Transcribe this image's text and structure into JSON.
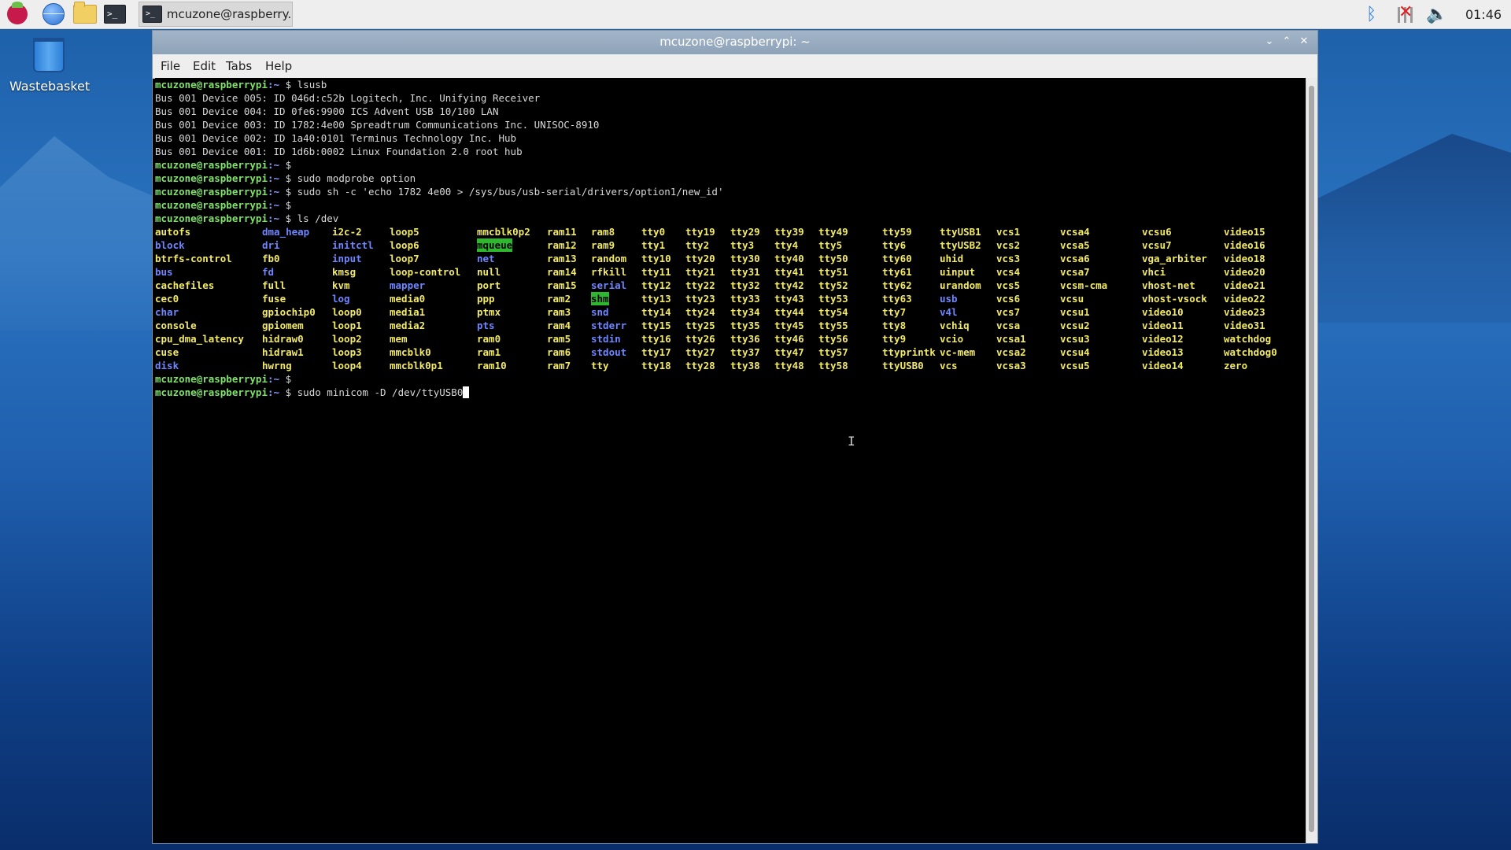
{
  "taskbar": {
    "launchers": [
      "raspberry-menu",
      "web-browser",
      "file-manager",
      "terminal"
    ],
    "active_task": {
      "label": "mcuzone@raspberry...",
      "icon": "terminal-icon"
    },
    "tray": {
      "bluetooth": "bluetooth-icon",
      "network": "network-disconnected-icon",
      "volume": "volume-icon"
    },
    "clock": "01:46"
  },
  "desktop": {
    "icons": [
      {
        "label": "Wastebasket",
        "icon": "trash-icon"
      }
    ]
  },
  "window": {
    "title": "mcuzone@raspberrypi: ~",
    "controls": [
      "minimize",
      "maximize",
      "close"
    ],
    "menu": [
      "File",
      "Edit",
      "Tabs",
      "Help"
    ]
  },
  "terminal": {
    "prompt": {
      "user": "mcuzone@raspberrypi",
      "path": "~",
      "symbol": "$"
    },
    "lines": [
      {
        "type": "cmd",
        "text": "lsusb"
      },
      {
        "type": "out",
        "text": "Bus 001 Device 005: ID 046d:c52b Logitech, Inc. Unifying Receiver"
      },
      {
        "type": "out",
        "text": "Bus 001 Device 004: ID 0fe6:9900 ICS Advent USB 10/100 LAN"
      },
      {
        "type": "out",
        "text": "Bus 001 Device 003: ID 1782:4e00 Spreadtrum Communications Inc. UNISOC-8910"
      },
      {
        "type": "out",
        "text": "Bus 001 Device 002: ID 1a40:0101 Terminus Technology Inc. Hub"
      },
      {
        "type": "out",
        "text": "Bus 001 Device 001: ID 1d6b:0002 Linux Foundation 2.0 root hub"
      },
      {
        "type": "cmd",
        "text": ""
      },
      {
        "type": "cmd",
        "text": "sudo modprobe option"
      },
      {
        "type": "cmd",
        "text": "sudo sh -c 'echo 1782 4e00 > /sys/bus/usb-serial/drivers/option1/new_id'"
      },
      {
        "type": "cmd",
        "text": ""
      },
      {
        "type": "cmd",
        "text": "ls /dev"
      }
    ],
    "ls_columns": [
      [
        [
          "autofs",
          "dev"
        ],
        [
          "block",
          "dir"
        ],
        [
          "btrfs-control",
          "dev"
        ],
        [
          "bus",
          "dir"
        ],
        [
          "cachefiles",
          "dev"
        ],
        [
          "cec0",
          "dev"
        ],
        [
          "char",
          "dir"
        ],
        [
          "console",
          "dev"
        ],
        [
          "cpu_dma_latency",
          "dev"
        ],
        [
          "cuse",
          "dev"
        ],
        [
          "disk",
          "dir"
        ]
      ],
      [
        [
          "dma_heap",
          "dir"
        ],
        [
          "dri",
          "dir"
        ],
        [
          "fb0",
          "dev"
        ],
        [
          "fd",
          "dir"
        ],
        [
          "full",
          "dev"
        ],
        [
          "fuse",
          "dev"
        ],
        [
          "gpiochip0",
          "dev"
        ],
        [
          "gpiomem",
          "dev"
        ],
        [
          "hidraw0",
          "dev"
        ],
        [
          "hidraw1",
          "dev"
        ],
        [
          "hwrng",
          "dev"
        ]
      ],
      [
        [
          "i2c-2",
          "dev"
        ],
        [
          "initctl",
          "dir"
        ],
        [
          "input",
          "dir"
        ],
        [
          "kmsg",
          "dev"
        ],
        [
          "kvm",
          "dev"
        ],
        [
          "log",
          "dir"
        ],
        [
          "loop0",
          "dev"
        ],
        [
          "loop1",
          "dev"
        ],
        [
          "loop2",
          "dev"
        ],
        [
          "loop3",
          "dev"
        ],
        [
          "loop4",
          "dev"
        ]
      ],
      [
        [
          "loop5",
          "dev"
        ],
        [
          "loop6",
          "dev"
        ],
        [
          "loop7",
          "dev"
        ],
        [
          "loop-control",
          "dev"
        ],
        [
          "mapper",
          "dir"
        ],
        [
          "media0",
          "dev"
        ],
        [
          "media1",
          "dev"
        ],
        [
          "media2",
          "dev"
        ],
        [
          "mem",
          "dev"
        ],
        [
          "mmcblk0",
          "dev"
        ],
        [
          "mmcblk0p1",
          "dev"
        ]
      ],
      [
        [
          "mmcblk0p2",
          "dev"
        ],
        [
          "mqueue",
          "sticky"
        ],
        [
          "net",
          "dir"
        ],
        [
          "null",
          "dev"
        ],
        [
          "port",
          "dev"
        ],
        [
          "ppp",
          "dev"
        ],
        [
          "ptmx",
          "dev"
        ],
        [
          "pts",
          "dir"
        ],
        [
          "ram0",
          "dev"
        ],
        [
          "ram1",
          "dev"
        ],
        [
          "ram10",
          "dev"
        ]
      ],
      [
        [
          "ram11",
          "dev"
        ],
        [
          "ram12",
          "dev"
        ],
        [
          "ram13",
          "dev"
        ],
        [
          "ram14",
          "dev"
        ],
        [
          "ram15",
          "dev"
        ],
        [
          "ram2",
          "dev"
        ],
        [
          "ram3",
          "dev"
        ],
        [
          "ram4",
          "dev"
        ],
        [
          "ram5",
          "dev"
        ],
        [
          "ram6",
          "dev"
        ],
        [
          "ram7",
          "dev"
        ]
      ],
      [
        [
          "ram8",
          "dev"
        ],
        [
          "ram9",
          "dev"
        ],
        [
          "random",
          "dev"
        ],
        [
          "rfkill",
          "dev"
        ],
        [
          "serial",
          "dir"
        ],
        [
          "shm",
          "sticky"
        ],
        [
          "snd",
          "dir"
        ],
        [
          "stderr",
          "dir"
        ],
        [
          "stdin",
          "dir"
        ],
        [
          "stdout",
          "dir"
        ],
        [
          "tty",
          "dev"
        ]
      ],
      [
        [
          "tty0",
          "dev"
        ],
        [
          "tty1",
          "dev"
        ],
        [
          "tty10",
          "dev"
        ],
        [
          "tty11",
          "dev"
        ],
        [
          "tty12",
          "dev"
        ],
        [
          "tty13",
          "dev"
        ],
        [
          "tty14",
          "dev"
        ],
        [
          "tty15",
          "dev"
        ],
        [
          "tty16",
          "dev"
        ],
        [
          "tty17",
          "dev"
        ],
        [
          "tty18",
          "dev"
        ]
      ],
      [
        [
          "tty19",
          "dev"
        ],
        [
          "tty2",
          "dev"
        ],
        [
          "tty20",
          "dev"
        ],
        [
          "tty21",
          "dev"
        ],
        [
          "tty22",
          "dev"
        ],
        [
          "tty23",
          "dev"
        ],
        [
          "tty24",
          "dev"
        ],
        [
          "tty25",
          "dev"
        ],
        [
          "tty26",
          "dev"
        ],
        [
          "tty27",
          "dev"
        ],
        [
          "tty28",
          "dev"
        ]
      ],
      [
        [
          "tty29",
          "dev"
        ],
        [
          "tty3",
          "dev"
        ],
        [
          "tty30",
          "dev"
        ],
        [
          "tty31",
          "dev"
        ],
        [
          "tty32",
          "dev"
        ],
        [
          "tty33",
          "dev"
        ],
        [
          "tty34",
          "dev"
        ],
        [
          "tty35",
          "dev"
        ],
        [
          "tty36",
          "dev"
        ],
        [
          "tty37",
          "dev"
        ],
        [
          "tty38",
          "dev"
        ]
      ],
      [
        [
          "tty39",
          "dev"
        ],
        [
          "tty4",
          "dev"
        ],
        [
          "tty40",
          "dev"
        ],
        [
          "tty41",
          "dev"
        ],
        [
          "tty42",
          "dev"
        ],
        [
          "tty43",
          "dev"
        ],
        [
          "tty44",
          "dev"
        ],
        [
          "tty45",
          "dev"
        ],
        [
          "tty46",
          "dev"
        ],
        [
          "tty47",
          "dev"
        ],
        [
          "tty48",
          "dev"
        ]
      ],
      [
        [
          "tty49",
          "dev"
        ],
        [
          "tty5",
          "dev"
        ],
        [
          "tty50",
          "dev"
        ],
        [
          "tty51",
          "dev"
        ],
        [
          "tty52",
          "dev"
        ],
        [
          "tty53",
          "dev"
        ],
        [
          "tty54",
          "dev"
        ],
        [
          "tty55",
          "dev"
        ],
        [
          "tty56",
          "dev"
        ],
        [
          "tty57",
          "dev"
        ],
        [
          "tty58",
          "dev"
        ]
      ],
      [
        [
          "tty59",
          "dev"
        ],
        [
          "tty6",
          "dev"
        ],
        [
          "tty60",
          "dev"
        ],
        [
          "tty61",
          "dev"
        ],
        [
          "tty62",
          "dev"
        ],
        [
          "tty63",
          "dev"
        ],
        [
          "tty7",
          "dev"
        ],
        [
          "tty8",
          "dev"
        ],
        [
          "tty9",
          "dev"
        ],
        [
          "ttyprintk",
          "dev"
        ],
        [
          "ttyUSB0",
          "dev"
        ]
      ],
      [
        [
          "ttyUSB1",
          "dev"
        ],
        [
          "ttyUSB2",
          "dev"
        ],
        [
          "uhid",
          "dev"
        ],
        [
          "uinput",
          "dev"
        ],
        [
          "urandom",
          "dev"
        ],
        [
          "usb",
          "dir"
        ],
        [
          "v4l",
          "dir"
        ],
        [
          "vchiq",
          "dev"
        ],
        [
          "vcio",
          "dev"
        ],
        [
          "vc-mem",
          "dev"
        ],
        [
          "vcs",
          "dev"
        ]
      ],
      [
        [
          "vcs1",
          "dev"
        ],
        [
          "vcs2",
          "dev"
        ],
        [
          "vcs3",
          "dev"
        ],
        [
          "vcs4",
          "dev"
        ],
        [
          "vcs5",
          "dev"
        ],
        [
          "vcs6",
          "dev"
        ],
        [
          "vcs7",
          "dev"
        ],
        [
          "vcsa",
          "dev"
        ],
        [
          "vcsa1",
          "dev"
        ],
        [
          "vcsa2",
          "dev"
        ],
        [
          "vcsa3",
          "dev"
        ]
      ],
      [
        [
          "vcsa4",
          "dev"
        ],
        [
          "vcsa5",
          "dev"
        ],
        [
          "vcsa6",
          "dev"
        ],
        [
          "vcsa7",
          "dev"
        ],
        [
          "vcsm-cma",
          "dev"
        ],
        [
          "vcsu",
          "dev"
        ],
        [
          "vcsu1",
          "dev"
        ],
        [
          "vcsu2",
          "dev"
        ],
        [
          "vcsu3",
          "dev"
        ],
        [
          "vcsu4",
          "dev"
        ],
        [
          "vcsu5",
          "dev"
        ]
      ],
      [
        [
          "vcsu6",
          "dev"
        ],
        [
          "vcsu7",
          "dev"
        ],
        [
          "vga_arbiter",
          "dev"
        ],
        [
          "vhci",
          "dev"
        ],
        [
          "vhost-net",
          "dev"
        ],
        [
          "vhost-vsock",
          "dev"
        ],
        [
          "video10",
          "dev"
        ],
        [
          "video11",
          "dev"
        ],
        [
          "video12",
          "dev"
        ],
        [
          "video13",
          "dev"
        ],
        [
          "video14",
          "dev"
        ]
      ],
      [
        [
          "video15",
          "dev"
        ],
        [
          "video16",
          "dev"
        ],
        [
          "video18",
          "dev"
        ],
        [
          "video20",
          "dev"
        ],
        [
          "video21",
          "dev"
        ],
        [
          "video22",
          "dev"
        ],
        [
          "video23",
          "dev"
        ],
        [
          "video31",
          "dev"
        ],
        [
          "watchdog",
          "dev"
        ],
        [
          "watchdog0",
          "dev"
        ],
        [
          "zero",
          "dev"
        ]
      ]
    ],
    "after_lines": [
      {
        "type": "cmd",
        "text": ""
      },
      {
        "type": "cmd",
        "text": "sudo minicom -D /dev/ttyUSB0",
        "cursor": true
      }
    ]
  },
  "colors": {
    "prompt_user": "#7fe36a",
    "prompt_path": "#8a9bff",
    "device": "#f2ea65",
    "directory": "#6e86ff",
    "sticky_bg": "#2db82d"
  }
}
